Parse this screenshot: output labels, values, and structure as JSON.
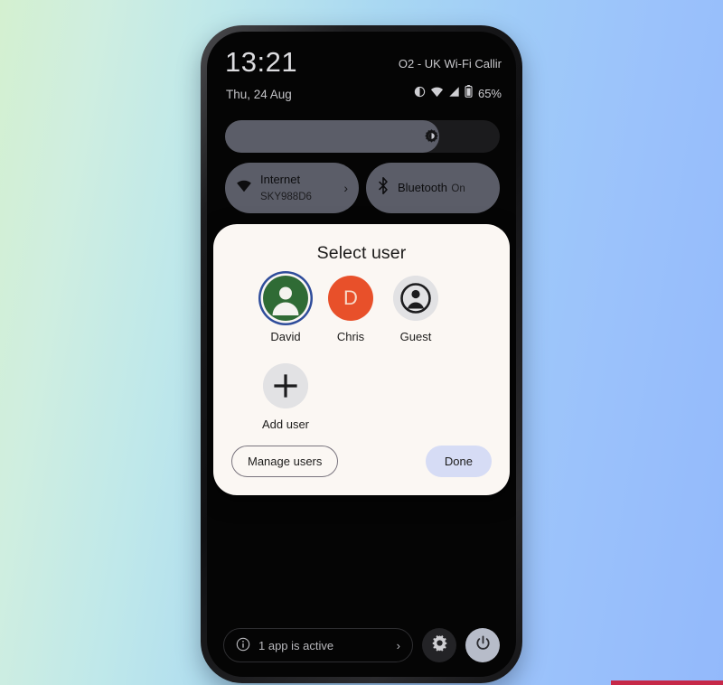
{
  "statusbar": {
    "clock": "13:21",
    "date": "Thu, 24 Aug",
    "carrier": "O2 - UK Wi-Fi Callir",
    "battery_percent": "65%",
    "icons": [
      "dnd-icon",
      "wifi-icon",
      "signal-icon",
      "battery-icon"
    ]
  },
  "brightness": {
    "icon": "brightness-icon",
    "level_percent": 78
  },
  "tiles": [
    {
      "icon": "wifi-icon",
      "title": "Internet",
      "subtitle": "SKY988D6",
      "chevron": "›"
    },
    {
      "icon": "bluetooth-icon",
      "title": "Bluetooth",
      "subtitle": "On",
      "chevron": ""
    }
  ],
  "dialog": {
    "title": "Select user",
    "users_row_one": [
      {
        "label": "David",
        "avatar": "person-avatar",
        "selected": true,
        "color": "#2f4d9b"
      },
      {
        "label": "Chris",
        "avatar": "letter-avatar",
        "initial": "D",
        "selected": false,
        "color": "#e8502a"
      },
      {
        "label": "Guest",
        "avatar": "guest-avatar",
        "selected": false,
        "color": "#e2e2e4"
      }
    ],
    "users_row_two": [
      {
        "label": "Add user",
        "avatar": "plus-icon",
        "selected": false,
        "color": "#e2e2e4"
      }
    ],
    "manage_users_label": "Manage users",
    "done_label": "Done",
    "done_color": "#d6dcf5",
    "surface_color": "#fbf7f3"
  },
  "bottom_bar": {
    "info_icon": "info-icon",
    "active_apps_label": "1 app is active",
    "chevron": "›",
    "settings_icon": "gear-icon",
    "power_icon": "power-icon"
  }
}
